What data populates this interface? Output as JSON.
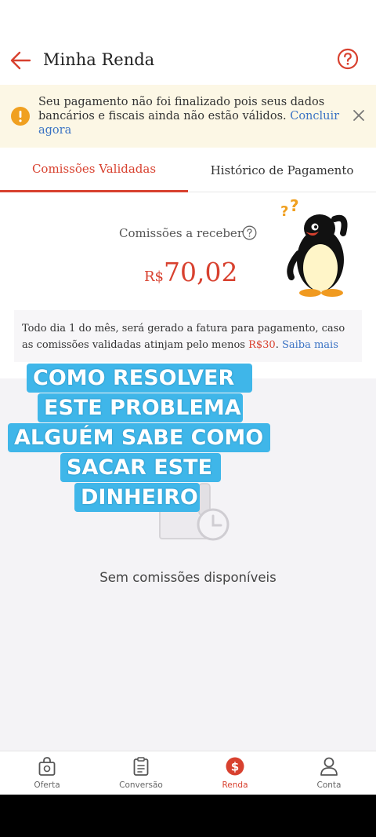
{
  "header": {
    "title": "Minha Renda"
  },
  "warning": {
    "message": "Seu pagamento não foi finalizado pois seus dados bancários e fiscais ainda não estão válidos.",
    "action_label": "Concluir agora"
  },
  "tabs": [
    {
      "label": "Comissões Validadas",
      "active": true
    },
    {
      "label": "Histórico de Pagamento",
      "active": false
    }
  ],
  "summary": {
    "label": "Comissões a receber",
    "currency": "R$",
    "amount": "70,02"
  },
  "info": {
    "text_before": "Todo dia 1 do mês, será gerado a fatura para pagamento, caso as comissões validadas atinjam pelo menos ",
    "min_amount": "R$30",
    "separator": ". ",
    "link_label": "Saiba mais"
  },
  "overlay_text": {
    "line1": "COMO  RESOLVER",
    "line2": "ESTE PROBLEMA",
    "line3": "ALGUÉM SABE COMO",
    "line4": "SACAR ESTE",
    "line5": "DINHEIRO"
  },
  "empty_state": {
    "message": "Sem comissões disponíveis"
  },
  "bottom_nav": [
    {
      "label": "Oferta",
      "icon": "bag-icon",
      "active": false
    },
    {
      "label": "Conversão",
      "icon": "clipboard-icon",
      "active": false
    },
    {
      "label": "Renda",
      "icon": "dollar-coin-icon",
      "active": true
    },
    {
      "label": "Conta",
      "icon": "person-icon",
      "active": false
    }
  ],
  "colors": {
    "accent": "#d8412f",
    "link": "#3b73c4",
    "warning_bg": "#fcf7e5",
    "overlay": "#3fb6e9"
  }
}
